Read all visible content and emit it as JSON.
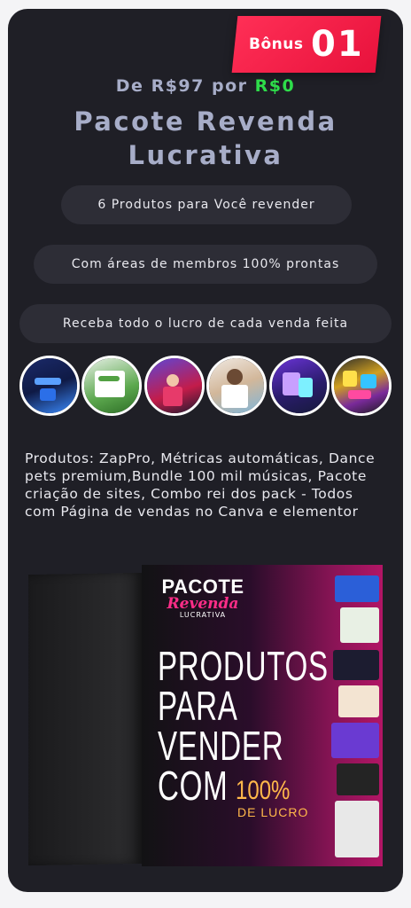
{
  "badge": {
    "label": "Bônus",
    "number": "01"
  },
  "price": {
    "prefix": "De ",
    "old": "R$97",
    "middle": " por ",
    "new": "R$0"
  },
  "title": "Pacote Revenda Lucrativa",
  "features": [
    "6 Produtos para Você revender",
    "Com áreas de membros 100% prontas",
    "Receba todo o lucro de cada venda feita"
  ],
  "thumbnails": [
    "zappro-icon",
    "metricas-icon",
    "dance-pets-icon",
    "musicas-icon",
    "sites-icon",
    "packs-icon"
  ],
  "description": "Produtos: ZapPro, Métricas automáticas, Dance pets premium,Bundle 100 mil músicas, Pacote criação de sites, Combo rei dos pack - Todos com Página de vendas no Canva e elementor",
  "box": {
    "logo_top": "PACOTE",
    "logo_mid": "Revenda",
    "logo_bottom": "LUCRATIVA",
    "line1": "PRODUTOS",
    "line2": "PARA",
    "line3": "VENDER",
    "line4": "COM",
    "percent": "100%",
    "lucro": "DE LUCRO"
  },
  "colors": {
    "card_bg": "#1f1f26",
    "accent_red": "#ff2f56",
    "price_green": "#2edc4a",
    "title_gray": "#a7adc8",
    "pill_bg": "#2d2d36"
  }
}
